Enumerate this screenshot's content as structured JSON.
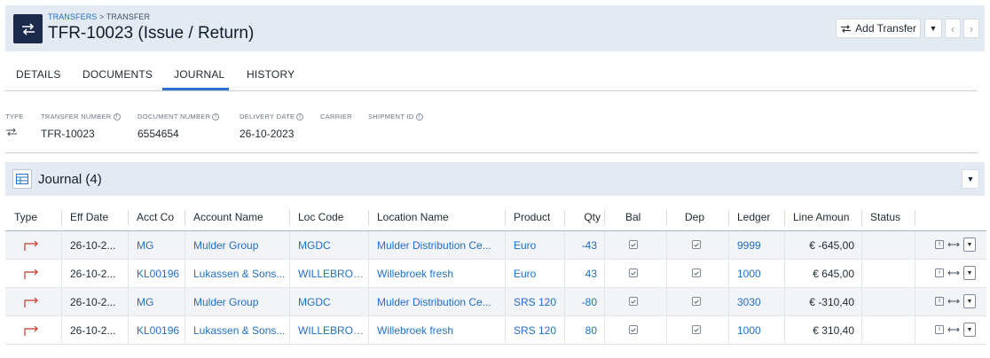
{
  "header": {
    "breadcrumb_link": "TRANSFERS",
    "breadcrumb_sep": " > ",
    "breadcrumb_current": "TRANSFER",
    "title": "TFR-10023 (Issue / Return)",
    "add_button_label": "Add Transfer"
  },
  "tabs": [
    {
      "label": "DETAILS",
      "active": false
    },
    {
      "label": "DOCUMENTS",
      "active": false
    },
    {
      "label": "JOURNAL",
      "active": true
    },
    {
      "label": "HISTORY",
      "active": false
    }
  ],
  "info": {
    "type_label": "TYPE",
    "transfer_number_label": "TRANSFER NUMBER",
    "transfer_number": "TFR-10023",
    "document_number_label": "DOCUMENT NUMBER",
    "document_number": "6554654",
    "delivery_date_label": "DELIVERY DATE",
    "delivery_date": "26-10-2023",
    "carrier_label": "CARRIER",
    "shipment_id_label": "SHIPMENT ID"
  },
  "journal": {
    "title": "Journal",
    "count": "(4)",
    "columns": [
      "Type",
      "Eff Date",
      "Acct Co",
      "Account Name",
      "Loc Code",
      "Location Name",
      "Product",
      "Qty",
      "Bal",
      "Dep",
      "Ledger",
      "Line Amoun",
      "Status"
    ],
    "rows": [
      {
        "eff_date": "26-10-2...",
        "acct_co": "MG",
        "account_name": "Mulder Group",
        "loc_code": "MGDC",
        "location_name": "Mulder Distribution Ce...",
        "product": "Euro",
        "qty": "-43",
        "bal": true,
        "dep": true,
        "ledger": "9999",
        "line_amount": "€ -645,00",
        "status": ""
      },
      {
        "eff_date": "26-10-2...",
        "acct_co": "KL00196",
        "account_name": "Lukassen & Sons...",
        "loc_code": "WILLEBROEK",
        "location_name": "Willebroek fresh",
        "product": "Euro",
        "qty": "43",
        "bal": true,
        "dep": true,
        "ledger": "1000",
        "line_amount": "€ 645,00",
        "status": ""
      },
      {
        "eff_date": "26-10-2...",
        "acct_co": "MG",
        "account_name": "Mulder Group",
        "loc_code": "MGDC",
        "location_name": "Mulder Distribution Ce...",
        "product": "SRS 120",
        "qty": "-80",
        "bal": true,
        "dep": true,
        "ledger": "3030",
        "line_amount": "€ -310,40",
        "status": ""
      },
      {
        "eff_date": "26-10-2...",
        "acct_co": "KL00196",
        "account_name": "Lukassen & Sons...",
        "loc_code": "WILLEBROEK",
        "location_name": "Willebroek fresh",
        "product": "SRS 120",
        "qty": "80",
        "bal": true,
        "dep": true,
        "ledger": "1000",
        "line_amount": "€ 310,40",
        "status": ""
      }
    ]
  },
  "colors": {
    "accent": "#2a6fcf",
    "link": "#1f6fc5",
    "header_bg": "#e4eaf2",
    "transfer_arrow": "#c0392b",
    "title_icon_bg": "#1b2a4a"
  },
  "icons": {
    "title": "transfer-arrows-icon",
    "add": "transfer-arrows-icon",
    "journal": "table-icon",
    "row_type": "return-arrow-icon"
  }
}
